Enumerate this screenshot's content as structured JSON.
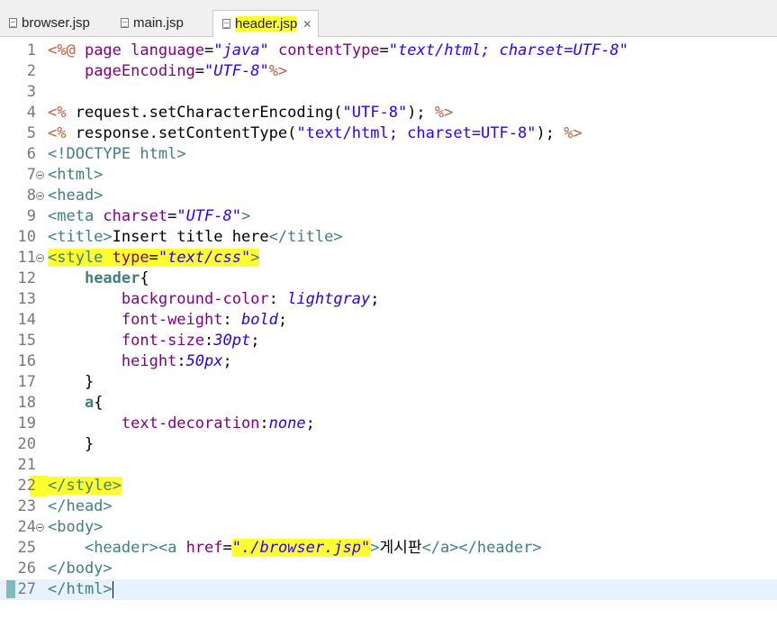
{
  "tabs": [
    {
      "label": "browser.jsp",
      "active": false,
      "highlighted": false
    },
    {
      "label": "main.jsp",
      "active": false,
      "highlighted": false
    },
    {
      "label": "header.jsp",
      "active": true,
      "highlighted": true
    }
  ],
  "tab_close_glyph": "✕",
  "colors": {
    "highlight": "#ffff2e",
    "tag": "#3f7f7f",
    "attribute": "#7f007f",
    "attribute_value": "#2a00ff",
    "jsp_delimiter": "#bf5f3f",
    "current_line": "#e8f2fe"
  },
  "current_line": 27,
  "lines": [
    {
      "n": "1",
      "tokens": [
        [
          "jsp",
          "<%@ "
        ],
        [
          "attr",
          "page "
        ],
        [
          "attr",
          "language"
        ],
        [
          "txt",
          "="
        ],
        [
          "val",
          "\"java\""
        ],
        [
          "txt",
          " "
        ],
        [
          "attr",
          "contentType"
        ],
        [
          "txt",
          "="
        ],
        [
          "val",
          "\"text/html; charset=UTF-8\""
        ]
      ]
    },
    {
      "n": "2",
      "tokens": [
        [
          "txt",
          "    "
        ],
        [
          "attr",
          "pageEncoding"
        ],
        [
          "txt",
          "="
        ],
        [
          "val",
          "\"UTF-8\""
        ],
        [
          "jsp",
          "%>"
        ]
      ]
    },
    {
      "n": "3",
      "tokens": []
    },
    {
      "n": "4",
      "tokens": [
        [
          "jsp",
          "<% "
        ],
        [
          "txt",
          "request.setCharacterEncoding("
        ],
        [
          "str",
          "\"UTF-8\""
        ],
        [
          "txt",
          "); "
        ],
        [
          "jsp",
          "%>"
        ]
      ]
    },
    {
      "n": "5",
      "tokens": [
        [
          "jsp",
          "<% "
        ],
        [
          "txt",
          "response.setContentType("
        ],
        [
          "str",
          "\"text/html; charset=UTF-8\""
        ],
        [
          "txt",
          "); "
        ],
        [
          "jsp",
          "%>"
        ]
      ]
    },
    {
      "n": "6",
      "tokens": [
        [
          "tag",
          "<!DOCTYPE "
        ],
        [
          "tag",
          "html"
        ],
        [
          "tag",
          ">"
        ]
      ]
    },
    {
      "n": "7",
      "fold": true,
      "tokens": [
        [
          "tag",
          "<html>"
        ]
      ]
    },
    {
      "n": "8",
      "fold": true,
      "tokens": [
        [
          "tag",
          "<head>"
        ]
      ]
    },
    {
      "n": "9",
      "tokens": [
        [
          "tag",
          "<meta "
        ],
        [
          "attr",
          "charset"
        ],
        [
          "txt",
          "="
        ],
        [
          "val",
          "\"UTF-8\""
        ],
        [
          "tag",
          ">"
        ]
      ]
    },
    {
      "n": "10",
      "tokens": [
        [
          "tag",
          "<title>"
        ],
        [
          "txt",
          "Insert title here"
        ],
        [
          "tag",
          "</title>"
        ]
      ]
    },
    {
      "n": "11",
      "fold": true,
      "tokens": [
        [
          "tag",
          "<style ",
          true
        ],
        [
          "attr",
          "type",
          true
        ],
        [
          "txt",
          "=",
          true
        ],
        [
          "val",
          "\"text/css\"",
          true
        ],
        [
          "tag",
          ">",
          true
        ]
      ]
    },
    {
      "n": "12",
      "tokens": [
        [
          "txt",
          "    "
        ],
        [
          "sel",
          "header"
        ],
        [
          "punct",
          "{"
        ]
      ]
    },
    {
      "n": "13",
      "tokens": [
        [
          "txt",
          "        "
        ],
        [
          "prop",
          "background-color"
        ],
        [
          "punct",
          ": "
        ],
        [
          "pval",
          "lightgray"
        ],
        [
          "punct",
          ";"
        ]
      ]
    },
    {
      "n": "14",
      "tokens": [
        [
          "txt",
          "        "
        ],
        [
          "prop",
          "font-weight"
        ],
        [
          "punct",
          ": "
        ],
        [
          "pval",
          "bold"
        ],
        [
          "punct",
          ";"
        ]
      ]
    },
    {
      "n": "15",
      "tokens": [
        [
          "txt",
          "        "
        ],
        [
          "prop",
          "font-size"
        ],
        [
          "punct",
          ":"
        ],
        [
          "pval",
          "30pt"
        ],
        [
          "punct",
          ";"
        ]
      ]
    },
    {
      "n": "16",
      "tokens": [
        [
          "txt",
          "        "
        ],
        [
          "prop",
          "height"
        ],
        [
          "punct",
          ":"
        ],
        [
          "pval",
          "50px"
        ],
        [
          "punct",
          ";"
        ]
      ]
    },
    {
      "n": "17",
      "tokens": [
        [
          "txt",
          "    "
        ],
        [
          "punct",
          "}"
        ]
      ]
    },
    {
      "n": "18",
      "tokens": [
        [
          "txt",
          "    "
        ],
        [
          "sel",
          "a"
        ],
        [
          "punct",
          "{"
        ]
      ]
    },
    {
      "n": "19",
      "tokens": [
        [
          "txt",
          "        "
        ],
        [
          "prop",
          "text-decoration"
        ],
        [
          "punct",
          ":"
        ],
        [
          "pval",
          "none"
        ],
        [
          "punct",
          ";"
        ]
      ]
    },
    {
      "n": "20",
      "tokens": [
        [
          "txt",
          "    "
        ],
        [
          "punct",
          "}"
        ]
      ]
    },
    {
      "n": "21",
      "tokens": []
    },
    {
      "n": "22",
      "tokens": [
        [
          "tag",
          "</style>",
          true
        ]
      ],
      "ln_highlight": true
    },
    {
      "n": "23",
      "tokens": [
        [
          "tag",
          "</head>"
        ]
      ]
    },
    {
      "n": "24",
      "fold": true,
      "tokens": [
        [
          "tag",
          "<body>"
        ]
      ]
    },
    {
      "n": "25",
      "tokens": [
        [
          "txt",
          "    "
        ],
        [
          "tag",
          "<header>"
        ],
        [
          "tag",
          "<a "
        ],
        [
          "attr",
          "href"
        ],
        [
          "txt",
          "="
        ],
        [
          "val",
          "\"./browser.jsp\"",
          true
        ],
        [
          "tag",
          ">"
        ],
        [
          "txt",
          "게시판"
        ],
        [
          "tag",
          "</a>"
        ],
        [
          "tag",
          "</header>"
        ]
      ]
    },
    {
      "n": "26",
      "tokens": [
        [
          "tag",
          "</body>"
        ]
      ]
    },
    {
      "n": "27",
      "tokens": [
        [
          "tag",
          "</html>"
        ]
      ],
      "cursor": true
    }
  ]
}
